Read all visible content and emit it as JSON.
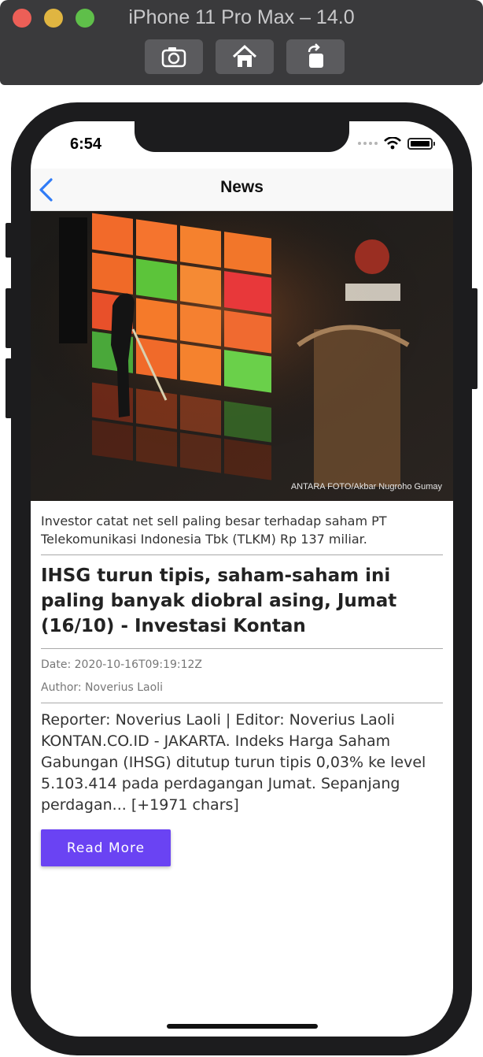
{
  "window": {
    "title": "iPhone 11 Pro Max – 14.0",
    "toolbar": [
      "camera-icon",
      "home-icon",
      "rotate-icon"
    ]
  },
  "status_bar": {
    "time": "6:54",
    "icons": [
      "signal-dots-icon",
      "wifi-icon",
      "battery-icon"
    ]
  },
  "nav": {
    "title": "News",
    "back_icon": "chevron-left-icon"
  },
  "article": {
    "image_credit": "ANTARA FOTO/Akbar Nugroho Gumay",
    "description": "Investor catat net sell paling besar terhadap saham PT Telekomunikasi Indonesia Tbk (TLKM) Rp 137 miliar.",
    "title": "IHSG turun tipis, saham-saham ini paling banyak diobral asing, Jumat (16/10) - Investasi Kontan",
    "date": "Date: 2020-10-16T09:19:12Z",
    "author": "Author: Noverius Laoli",
    "content": "Reporter: Noverius Laoli | Editor: Noverius Laoli KONTAN.CO.ID -  JAKARTA. Indeks Harga Saham Gabungan (IHSG) ditutup turun tipis 0,03% ke level 5.103.414 pada perdagangan Jumat.  Sepanjang perdagan... [+1971 chars]",
    "read_more": "Read More"
  },
  "colors": {
    "accent": "#6a43f3",
    "ios_blue": "#2f7bf6"
  }
}
